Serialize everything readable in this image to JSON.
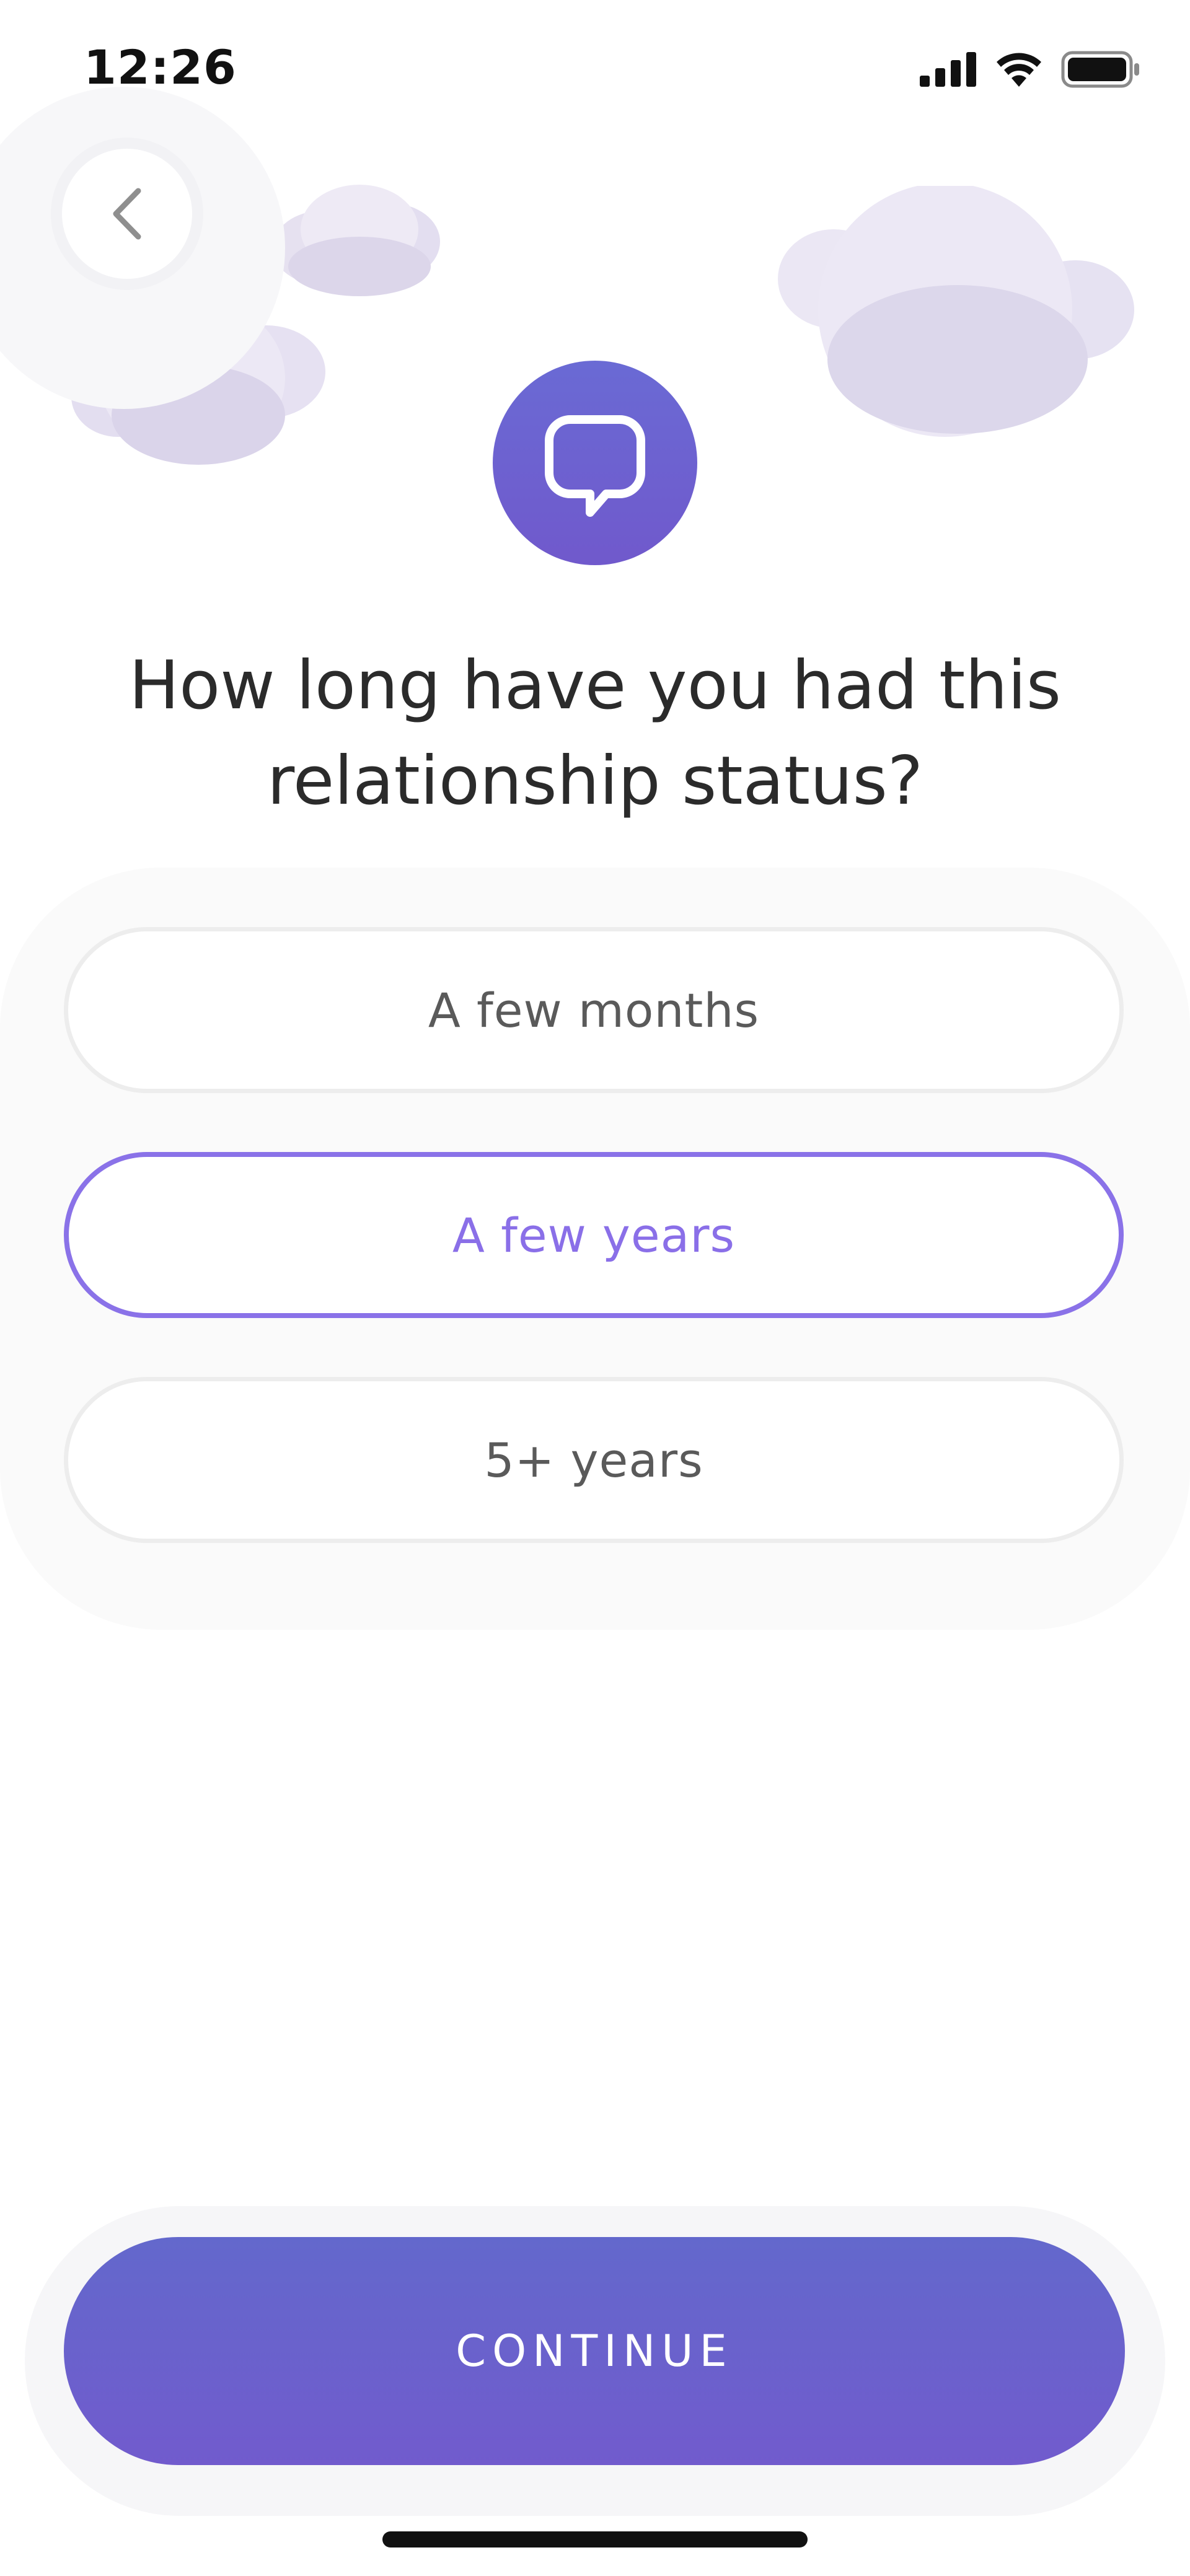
{
  "status_bar": {
    "time": "12:26",
    "icons": [
      "signal-icon",
      "wifi-icon",
      "battery-icon"
    ]
  },
  "back_icon": "chevron-left-icon",
  "app_icon": "speech-bubble-icon",
  "question": "How long have you had this relationship status?",
  "options": [
    {
      "label": "A few months",
      "selected": false
    },
    {
      "label": "A few years",
      "selected": true
    },
    {
      "label": "5+ years",
      "selected": false
    }
  ],
  "continue_label": "CONTINUE",
  "colors": {
    "accent": "#8a72e8",
    "button_gradient_top": "#6368cc",
    "button_gradient_bottom": "#715bcd",
    "text_dark": "#2b2b2b"
  }
}
